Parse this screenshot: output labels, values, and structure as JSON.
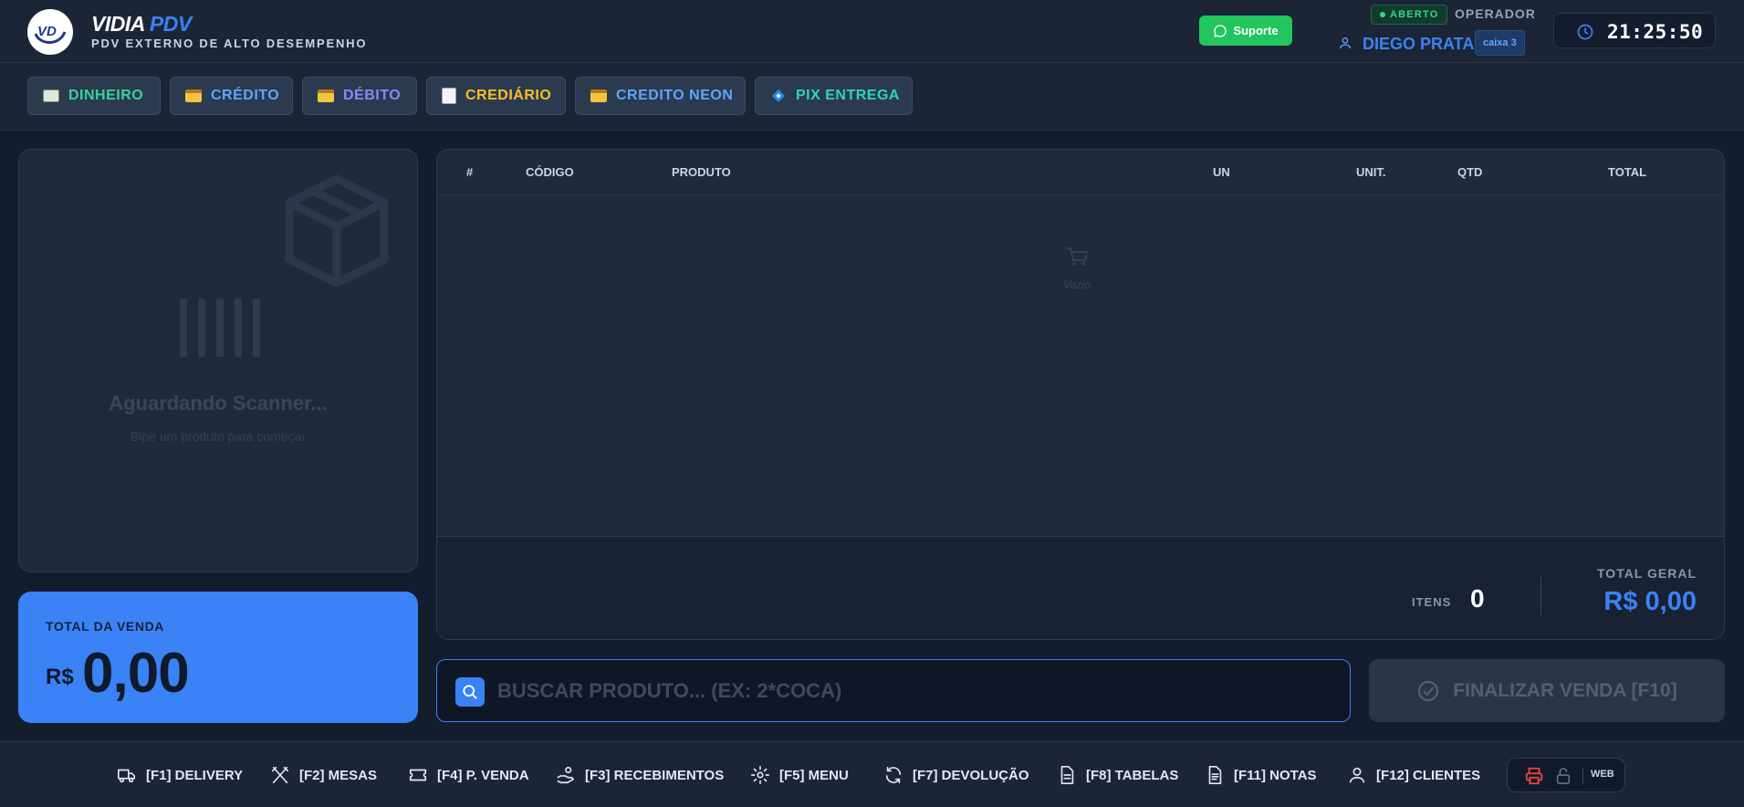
{
  "header": {
    "brand_part1": "VIDIA",
    "brand_part2": "PDV",
    "subtitle": "PDV EXTERNO DE ALTO DESEMPENHO",
    "support_label": "Suporte",
    "status": "ABERTO",
    "operator_label": "OPERADOR",
    "operator_name": "DIEGO PRATA",
    "register": "caixa 3",
    "clock": "21:25:50"
  },
  "payments": [
    {
      "label": "DINHEIRO",
      "color": "#34d399"
    },
    {
      "label": "CRÉDITO",
      "color": "#60a5fa"
    },
    {
      "label": "DÉBITO",
      "color": "#818cf8"
    },
    {
      "label": "CREDIÁRIO",
      "color": "#fbbf24"
    },
    {
      "label": "CREDITO NEON",
      "color": "#60a5fa"
    },
    {
      "label": "PIX ENTREGA",
      "color": "#2dd4bf"
    }
  ],
  "scanner": {
    "title": "Aguardando Scanner...",
    "subtitle": "Bipe um produto para começar"
  },
  "total_sale": {
    "label": "TOTAL DA VENDA",
    "currency": "R$",
    "value": "0,00"
  },
  "table": {
    "columns": [
      "#",
      "CÓDIGO",
      "PRODUTO",
      "UN",
      "UNIT.",
      "QTD",
      "TOTAL"
    ],
    "empty_text": "Vazio",
    "items_label": "ITENS",
    "items_value": "0",
    "grand_total_label": "TOTAL GERAL",
    "grand_total_value": "R$ 0,00"
  },
  "search": {
    "placeholder": "BUSCAR PRODUTO... (EX: 2*COCA)",
    "value": ""
  },
  "finalize_label": "FINALIZAR VENDA [F10]",
  "shortcuts": [
    {
      "label": "[F1] DELIVERY",
      "icon": "truck-icon"
    },
    {
      "label": "[F2] MESAS",
      "icon": "utensils-icon"
    },
    {
      "label": "[F4] P. VENDA",
      "icon": "ticket-icon"
    },
    {
      "label": "[F3] RECEBIMENTOS",
      "icon": "hand-coins-icon"
    },
    {
      "label": "[F5] MENU",
      "icon": "gear-icon"
    },
    {
      "label": "[F7] DEVOLUÇÃO",
      "icon": "refresh-icon"
    },
    {
      "label": "[F8] TABELAS",
      "icon": "document-icon"
    },
    {
      "label": "[F11] NOTAS",
      "icon": "notes-icon"
    },
    {
      "label": "[F12] CLIENTES",
      "icon": "user-icon"
    }
  ],
  "system": {
    "web_label": "WEB",
    "printer_color": "#ef4444"
  },
  "colors": {
    "accent": "#3b82f6",
    "success": "#22c55e",
    "background": "#141d2e"
  }
}
